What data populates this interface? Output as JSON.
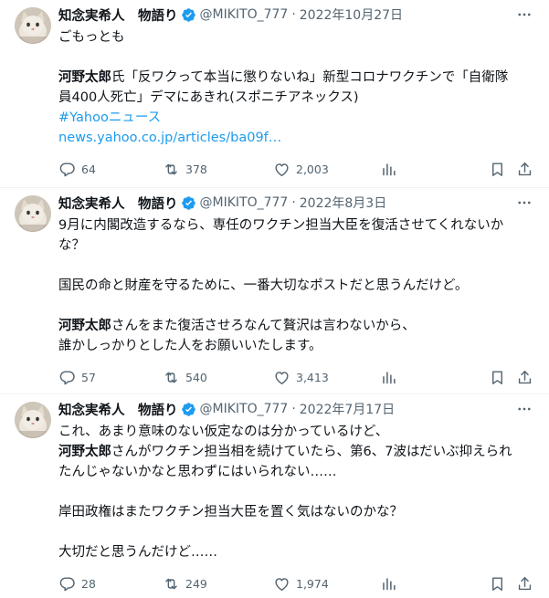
{
  "colors": {
    "text": "#0f1419",
    "muted": "#536471",
    "link": "#1d9bf0",
    "verified": "#1d9bf0",
    "divider": "#eff3f4"
  },
  "tweets": [
    {
      "author": "知念実希人　物語り",
      "handle": "@MIKITO_777",
      "separator": "·",
      "date": "2022年10月27日",
      "lines": [
        [
          {
            "t": "ごもっとも",
            "s": "plain"
          }
        ],
        [],
        [
          {
            "t": "河野太郎",
            "s": "bold"
          },
          {
            "t": "氏「反ワクって本当に懲りないね」新型コロナワクチンで「自衛隊",
            "s": "plain"
          }
        ],
        [
          {
            "t": "員400人死亡」デマにあきれ(スポニチアネックス)",
            "s": "plain"
          }
        ],
        [
          {
            "t": "#Yahooニュース",
            "s": "link"
          }
        ],
        [
          {
            "t": "news.yahoo.co.jp/articles/ba09f…",
            "s": "link"
          }
        ]
      ],
      "stats": {
        "replies": "64",
        "retweets": "378",
        "likes": "2,003"
      }
    },
    {
      "author": "知念実希人　物語り",
      "handle": "@MIKITO_777",
      "separator": "·",
      "date": "2022年8月3日",
      "lines": [
        [
          {
            "t": "9月に内閣改造するなら、専任のワクチン担当大臣を復活させてくれないか",
            "s": "plain"
          }
        ],
        [
          {
            "t": "な？",
            "s": "plain"
          }
        ],
        [],
        [
          {
            "t": "国民の命と財産を守るために、一番大切なポストだと思うんだけど。",
            "s": "plain"
          }
        ],
        [],
        [
          {
            "t": "河野太郎",
            "s": "bold"
          },
          {
            "t": "さんをまた復活させろなんて贅沢は言わないから、",
            "s": "plain"
          }
        ],
        [
          {
            "t": "誰かしっかりとした人をお願いいたします。",
            "s": "plain"
          }
        ]
      ],
      "stats": {
        "replies": "57",
        "retweets": "540",
        "likes": "3,413"
      }
    },
    {
      "author": "知念実希人　物語り",
      "handle": "@MIKITO_777",
      "separator": "·",
      "date": "2022年7月17日",
      "lines": [
        [
          {
            "t": "これ、あまり意味のない仮定なのは分かっているけど、",
            "s": "plain"
          }
        ],
        [
          {
            "t": "河野太郎",
            "s": "bold"
          },
          {
            "t": "さんがワクチン担当相を続けていたら、第6、7波はだいぶ抑えられ",
            "s": "plain"
          }
        ],
        [
          {
            "t": "たんじゃないかなと思わずにはいられない……",
            "s": "plain"
          }
        ],
        [],
        [
          {
            "t": "岸田政権はまたワクチン担当大臣を置く気はないのかな？",
            "s": "plain"
          }
        ],
        [],
        [
          {
            "t": "大切だと思うんだけど……",
            "s": "plain"
          }
        ]
      ],
      "stats": {
        "replies": "28",
        "retweets": "249",
        "likes": "1,974"
      }
    }
  ],
  "icons": {
    "more": "more-icon",
    "reply": "reply-icon",
    "retweet": "retweet-icon",
    "like": "like-icon",
    "views": "views-icon",
    "bookmark": "bookmark-icon",
    "share": "share-icon",
    "verified": "verified-badge-icon"
  }
}
